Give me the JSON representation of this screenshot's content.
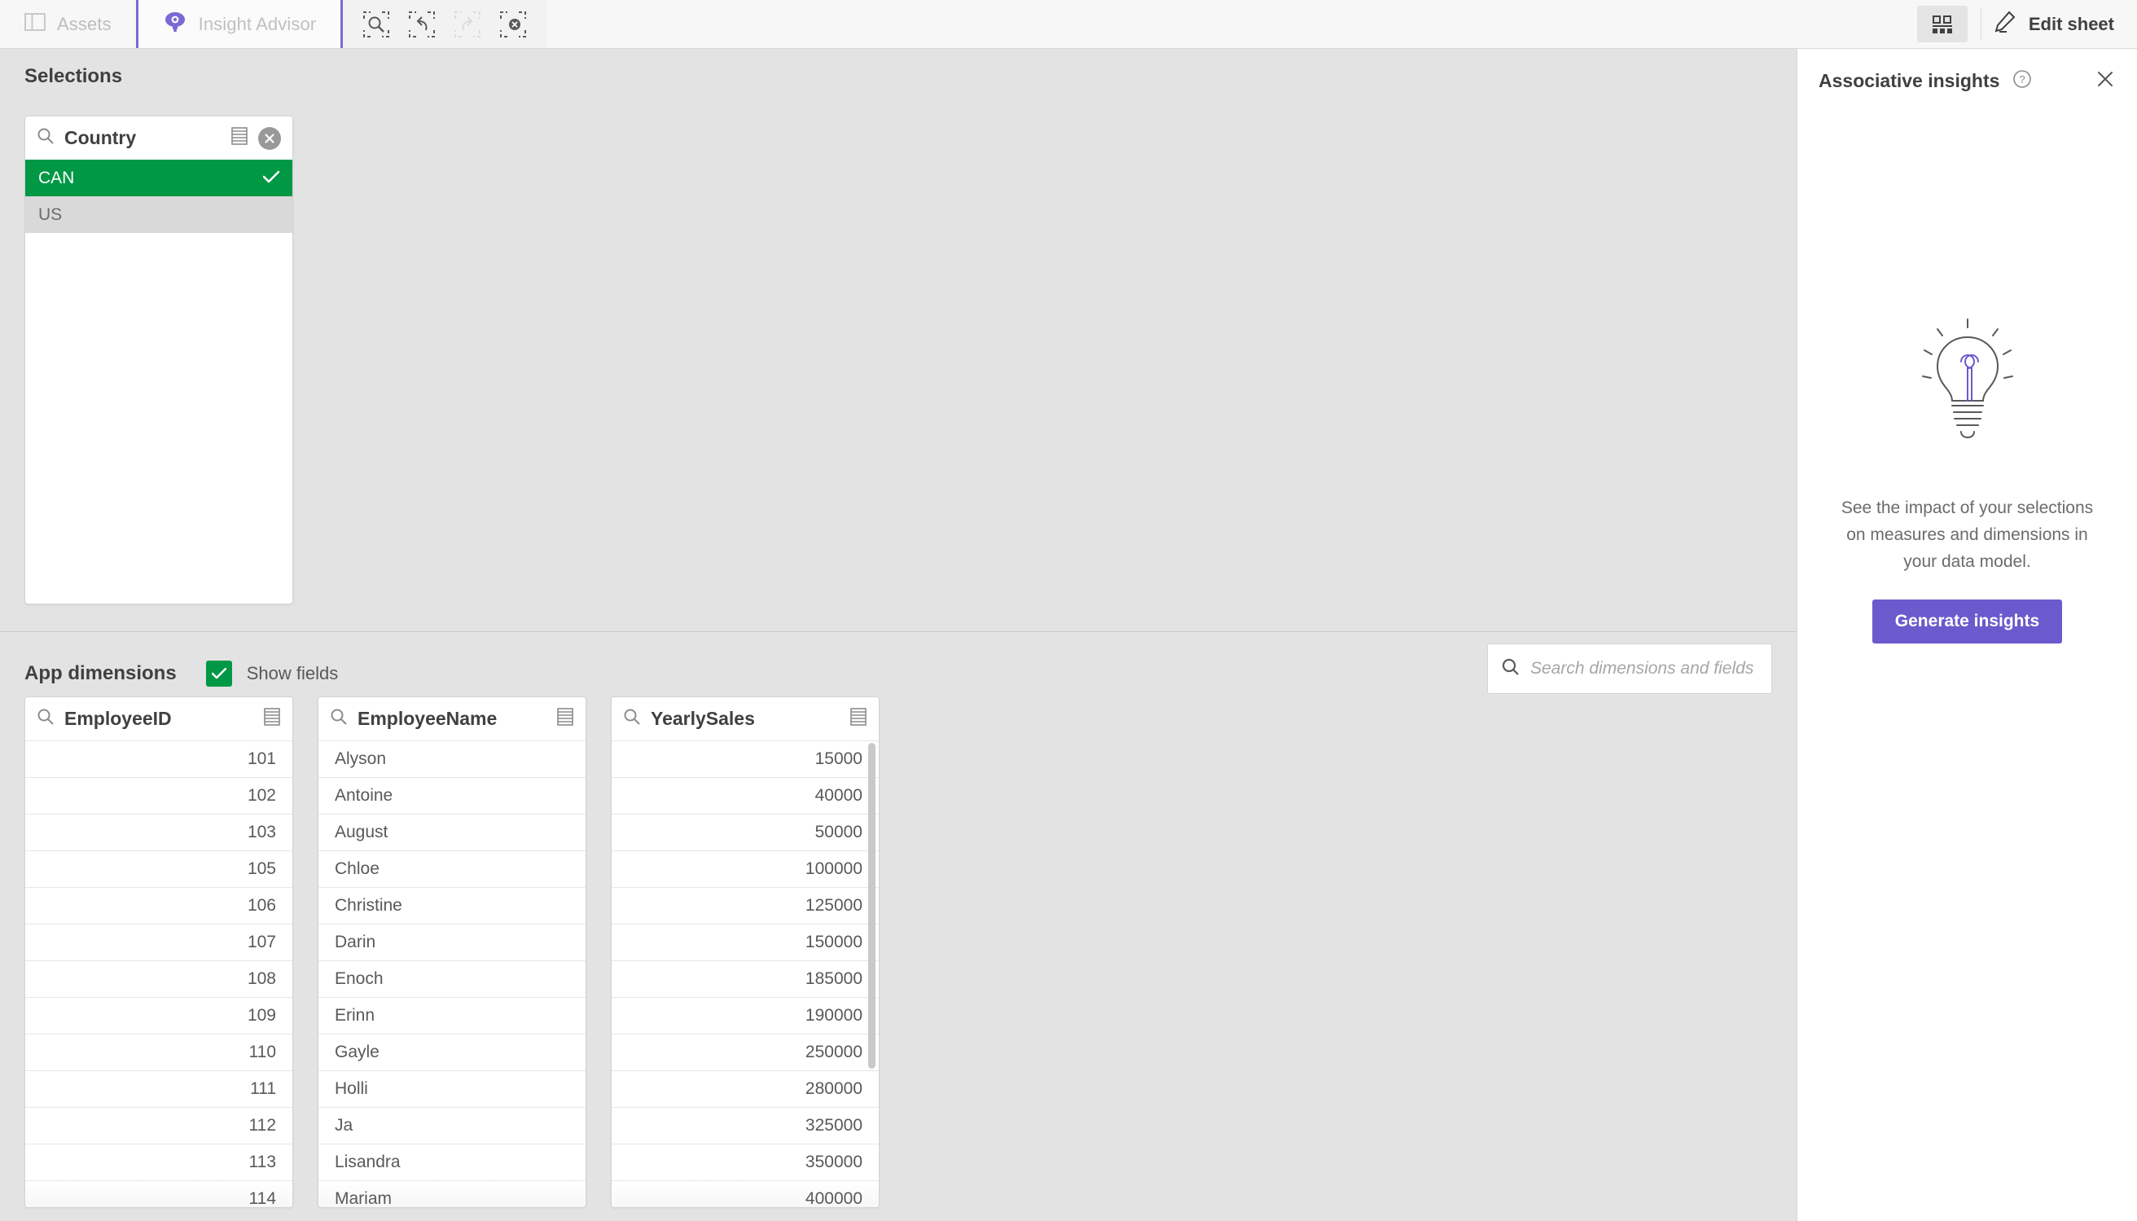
{
  "toolbar": {
    "assets_label": "Assets",
    "advisor_label": "Insight Advisor",
    "selection_tools": [
      {
        "name": "selection-search-icon",
        "label": "Search selections",
        "disabled": false
      },
      {
        "name": "step-back-icon",
        "label": "Step back",
        "disabled": false
      },
      {
        "name": "step-forward-icon",
        "label": "Step forward",
        "disabled": true
      },
      {
        "name": "clear-all-selections-icon",
        "label": "Clear all selections",
        "disabled": false
      }
    ],
    "sheet_button_label": "Sheets",
    "edit_sheet_label": "Edit sheet"
  },
  "selections": {
    "title": "Selections",
    "field": {
      "name": "Country",
      "values": [
        {
          "value": "CAN",
          "state": "selected"
        },
        {
          "value": "US",
          "state": "excluded"
        }
      ]
    }
  },
  "app_dimensions": {
    "title": "App dimensions",
    "show_fields_label": "Show fields",
    "show_fields_checked": true,
    "search_placeholder": "Search dimensions and fields",
    "search_value": "",
    "fields": [
      {
        "name": "EmployeeID",
        "align": "right",
        "values": [
          "101",
          "102",
          "103",
          "105",
          "106",
          "107",
          "108",
          "109",
          "110",
          "111",
          "112",
          "113",
          "114"
        ],
        "scrollbar": false
      },
      {
        "name": "EmployeeName",
        "align": "left",
        "values": [
          "Alyson",
          "Antoine",
          "August",
          "Chloe",
          "Christine",
          "Darin",
          "Enoch",
          "Erinn",
          "Gayle",
          "Holli",
          "Ja",
          "Lisandra",
          "Mariam"
        ],
        "scrollbar": false
      },
      {
        "name": "YearlySales",
        "align": "right",
        "values": [
          "15000",
          "40000",
          "50000",
          "100000",
          "125000",
          "150000",
          "185000",
          "190000",
          "250000",
          "280000",
          "325000",
          "350000",
          "400000"
        ],
        "scrollbar": true
      }
    ]
  },
  "associative_insights": {
    "title": "Associative insights",
    "description": "See the impact of your selections on measures and dimensions in your data model.",
    "generate_label": "Generate insights"
  },
  "colors": {
    "selected_green": "#009845",
    "excluded_gray": "#d9d9d9",
    "accent_purple": "#6a5acd",
    "advisor_purple": "#7b69d4",
    "background": "#e3e3e3"
  }
}
